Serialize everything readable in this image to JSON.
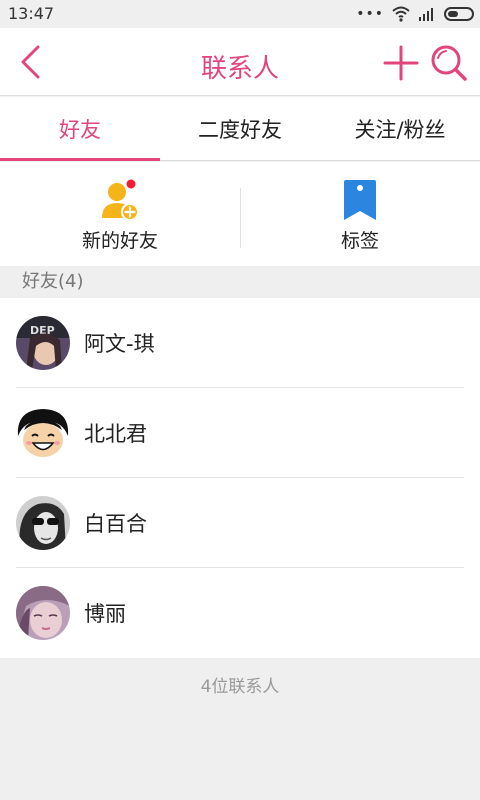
{
  "status": {
    "time": "13:47"
  },
  "header": {
    "title": "联系人"
  },
  "tabs": [
    {
      "label": "好友",
      "active": true
    },
    {
      "label": "二度好友",
      "active": false
    },
    {
      "label": "关注/粉丝",
      "active": false
    }
  ],
  "quick_actions": [
    {
      "label": "新的好友",
      "icon": "person-add-icon",
      "has_badge": true
    },
    {
      "label": "标签",
      "icon": "bookmark-icon"
    }
  ],
  "section": {
    "title": "好友(4)"
  },
  "contacts": [
    {
      "name": "阿文-琪",
      "avatar": "avatar-photo"
    },
    {
      "name": "北北君",
      "avatar": "avatar-cartoon"
    },
    {
      "name": "白百合",
      "avatar": "avatar-photo"
    },
    {
      "name": "博丽",
      "avatar": "avatar-photo"
    }
  ],
  "footer": {
    "count_text": "4位联系人"
  },
  "colors": {
    "accent": "#e1457b",
    "icon_yellow": "#f5b41a",
    "icon_blue": "#2b86e0",
    "badge_red": "#f01f2f"
  }
}
